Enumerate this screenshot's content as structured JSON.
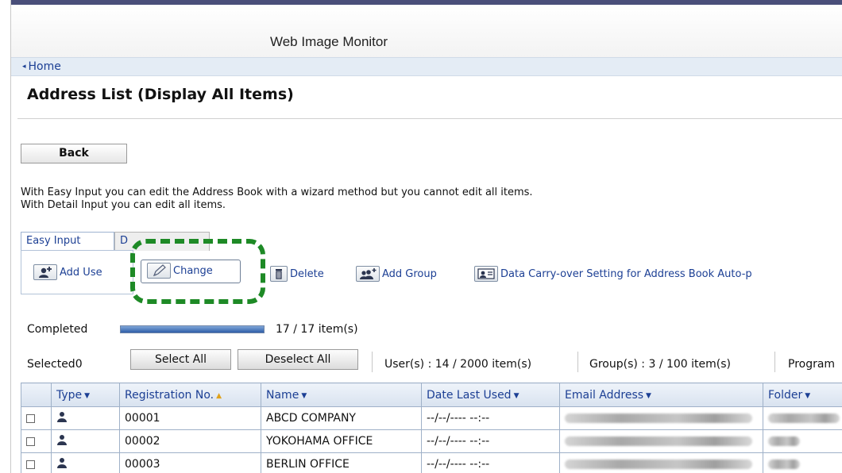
{
  "app": {
    "title": "Web Image Monitor"
  },
  "nav": {
    "home": "Home"
  },
  "page": {
    "title": "Address List (Display All Items)",
    "back_label": "Back",
    "description_line1": "With Easy Input you can edit the Address Book with a wizard method but you cannot edit all items.",
    "description_line2": "With Detail Input you can edit all items."
  },
  "tabs": [
    {
      "label": "Easy Input",
      "active": true
    },
    {
      "label": "D",
      "active": false
    }
  ],
  "toolbar": {
    "add_user": "Add Use",
    "change": "Change",
    "delete": "Delete",
    "add_group": "Add Group",
    "carry_over": "Data Carry-over Setting for Address Book Auto-p"
  },
  "status": {
    "label": "Completed",
    "progress_fraction": 1.0,
    "count": "17 / 17 item(s)"
  },
  "selection": {
    "selected_text": "Selected0",
    "select_all": "Select All",
    "deselect_all": "Deselect All",
    "users": "User(s) : 14 / 2000 item(s)",
    "groups": "Group(s) : 3 / 100 item(s)",
    "programs": "Program"
  },
  "table": {
    "headers": {
      "type": "Type",
      "registration": "Registration No.",
      "name": "Name",
      "date_last_used": "Date Last Used",
      "email": "Email Address",
      "folder": "Folder"
    },
    "rows": [
      {
        "registration": "00001",
        "name": "ABCD COMPANY",
        "date_last_used": "--/--/---- --:--"
      },
      {
        "registration": "00002",
        "name": "YOKOHAMA OFFICE",
        "date_last_used": "--/--/---- --:--"
      },
      {
        "registration": "00003",
        "name": "BERLIN OFFICE",
        "date_last_used": "--/--/---- --:--"
      }
    ]
  },
  "colors": {
    "link_blue": "#1c3f94",
    "highlight_green": "#1e8a26",
    "header_bar": "#e4ecf5",
    "table_border": "#9fb1c8"
  },
  "icons": {
    "add_user": "add-user-icon",
    "change": "pencil-icon",
    "delete": "trash-icon",
    "add_group": "add-group-icon",
    "carry_over": "card-icon",
    "user_type": "user-icon"
  }
}
